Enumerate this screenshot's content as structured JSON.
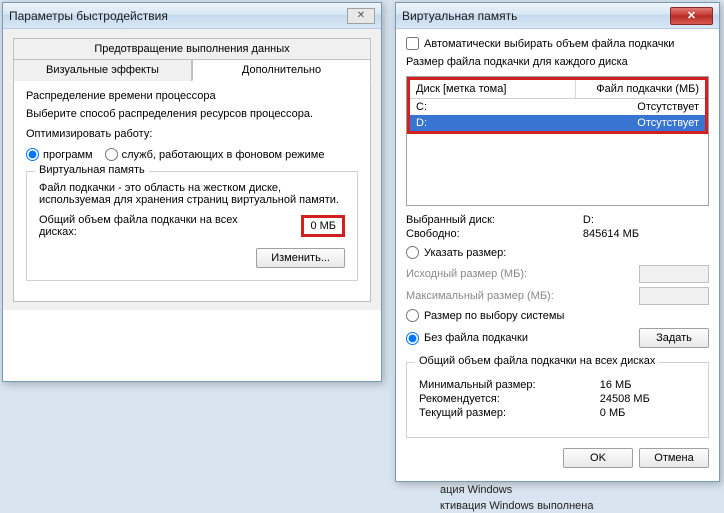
{
  "win1": {
    "title": "Параметры быстродействия",
    "tabs": {
      "prevention": "Предотвращение выполнения данных",
      "visual": "Визуальные эффекты",
      "advanced": "Дополнительно"
    },
    "cpu": {
      "title": "Распределение времени процессора",
      "desc": "Выберите способ распределения ресурсов процессора.",
      "optimize": "Оптимизировать работу:",
      "programs": "программ",
      "services": "служб, работающих в фоновом режиме"
    },
    "vm": {
      "title": "Виртуальная память",
      "desc": "Файл подкачки - это область на жестком диске, используемая для хранения страниц виртуальной памяти.",
      "total_label": "Общий объем файла подкачки на всех дисках:",
      "total_value": "0 МБ",
      "change": "Изменить..."
    }
  },
  "win2": {
    "title": "Виртуальная память",
    "auto": "Автоматически выбирать объем файла подкачки",
    "per_disk": "Размер файла подкачки для каждого диска",
    "col_disk": "Диск [метка тома]",
    "col_pf": "Файл подкачки (МБ)",
    "rows": [
      {
        "disk": "C:",
        "pf": "Отсутствует"
      },
      {
        "disk": "D:",
        "pf": "Отсутствует"
      }
    ],
    "selected": {
      "disk_label": "Выбранный диск:",
      "disk_value": "D:",
      "free_label": "Свободно:",
      "free_value": "845614 МБ"
    },
    "opt_custom": "Указать размер:",
    "init_label": "Исходный размер (МБ):",
    "max_label": "Максимальный размер (МБ):",
    "opt_system": "Размер по выбору системы",
    "opt_none": "Без файла подкачки",
    "set": "Задать",
    "totals": {
      "title": "Общий объем файла подкачки на всех дисках",
      "min_label": "Минимальный размер:",
      "min_value": "16 МБ",
      "rec_label": "Рекомендуется:",
      "rec_value": "24508 МБ",
      "cur_label": "Текущий размер:",
      "cur_value": "0 МБ"
    },
    "ok": "OK",
    "cancel": "Отмена"
  },
  "activation": {
    "line1": "ация Windows",
    "line2": "ктивация Windows выполнена"
  }
}
